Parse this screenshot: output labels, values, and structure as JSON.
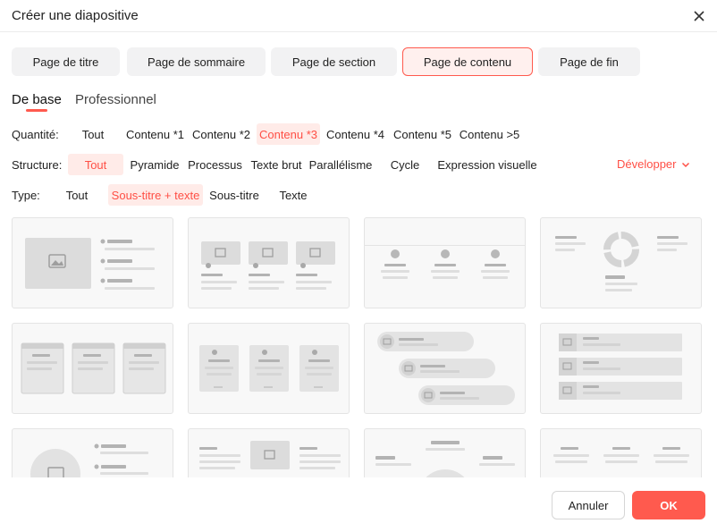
{
  "dialog": {
    "title": "Créer une diapositive"
  },
  "page_tabs": [
    {
      "label": "Page de titre",
      "active": false
    },
    {
      "label": "Page de sommaire",
      "active": false
    },
    {
      "label": "Page de section",
      "active": false
    },
    {
      "label": "Page de contenu",
      "active": true
    },
    {
      "label": "Page de fin",
      "active": false
    }
  ],
  "sub_tabs": [
    {
      "label": "De base",
      "active": true
    },
    {
      "label": "Professionnel",
      "active": false
    }
  ],
  "filters": {
    "quantity": {
      "label": "Quantité:",
      "options": [
        "Tout",
        "Contenu *1",
        "Contenu *2",
        "Contenu *3",
        "Contenu *4",
        "Contenu *5",
        "Contenu >5"
      ],
      "selected": "Contenu *3"
    },
    "structure": {
      "label": "Structure:",
      "options": [
        "Tout",
        "Pyramide",
        "Processus",
        "Texte brut",
        "Parallélisme",
        "Cycle",
        "Expression visuelle"
      ],
      "selected": "Tout",
      "expand_label": "Développer"
    },
    "type": {
      "label": "Type:",
      "options": [
        "Tout",
        "Sous-titre + texte",
        "Sous-titre",
        "Texte"
      ],
      "selected": "Sous-titre + texte"
    }
  },
  "templates_count_visible": 12,
  "footer": {
    "cancel_label": "Annuler",
    "ok_label": "OK"
  },
  "colors": {
    "accent": "#ff5a4e",
    "accent_light": "#ffebe8",
    "card_bg": "#f8f8f8",
    "placeholder": "#d9d9d9"
  }
}
